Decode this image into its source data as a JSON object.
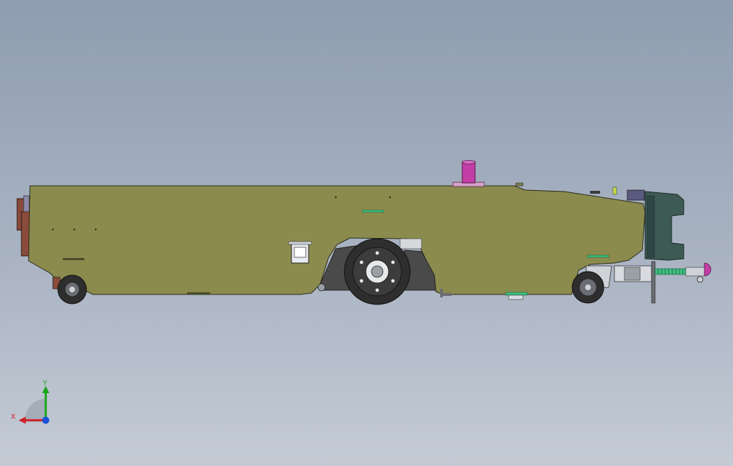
{
  "viewport": {
    "background_top": "#8f9db0",
    "background_bottom": "#c4cbd5"
  },
  "model": {
    "body_color": "#8b8b4e",
    "edge_color": "#2a2a1a",
    "wheel_color": "#2e2e2e",
    "accent_magenta": "#c23ea6",
    "accent_teal": "#3e5a55",
    "accent_green": "#3fbf7f",
    "accent_rust": "#8a4b3c"
  },
  "triad": {
    "x_label": "X",
    "y_label": "Y",
    "x_color": "#d0202a",
    "y_color": "#19a519",
    "z_color": "#1a4fd6"
  }
}
